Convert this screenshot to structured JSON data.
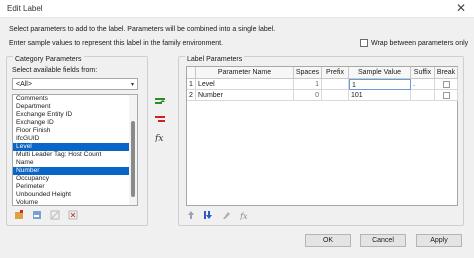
{
  "window": {
    "title": "Edit Label"
  },
  "desc": {
    "line1": "Select parameters to add to the label.  Parameters will be combined into a single label.",
    "line2": "Enter sample values to represent this label in the family environment."
  },
  "wrap_checkbox": {
    "label": "Wrap between parameters only",
    "checked": false
  },
  "left_group": {
    "title": "Category Parameters",
    "fields_label": "Select available fields from:",
    "select_value": "<All>",
    "items": [
      "Comments",
      "Department",
      "Exchange Entity ID",
      "Exchange ID",
      "Floor Finish",
      "IfcGUID",
      "Level",
      "Multi Leader Tag: Host Count",
      "Name",
      "Number",
      "Occupancy",
      "Perimeter",
      "Unbounded Height",
      "Volume"
    ],
    "selected_items": [
      "Level",
      "Number"
    ]
  },
  "right_group": {
    "title": "Label Parameters",
    "columns": [
      "Parameter Name",
      "Spaces",
      "Prefix",
      "Sample Value",
      "Suffix",
      "Break"
    ],
    "rows": [
      {
        "num": "1",
        "name": "Level",
        "spaces": "1",
        "prefix": "",
        "sample": "1",
        "suffix": ".",
        "break": false
      },
      {
        "num": "2",
        "name": "Number",
        "spaces": "0",
        "prefix": "",
        "sample": "101",
        "suffix": "",
        "break": false
      }
    ]
  },
  "icons": {
    "add": "add-parameter-icon",
    "remove": "remove-parameter-icon",
    "fx": "fx-icon",
    "left1": "new-parameter-icon",
    "left2": "edit-parameter-icon",
    "left3": "edit-parameter-disabled-icon",
    "left4": "delete-parameter-icon",
    "right1": "move-up-icon",
    "right2": "move-down-icon",
    "right3": "edit-format-icon",
    "right4": "formula-icon"
  },
  "buttons": {
    "ok": "OK",
    "cancel": "Cancel",
    "apply": "Apply"
  }
}
